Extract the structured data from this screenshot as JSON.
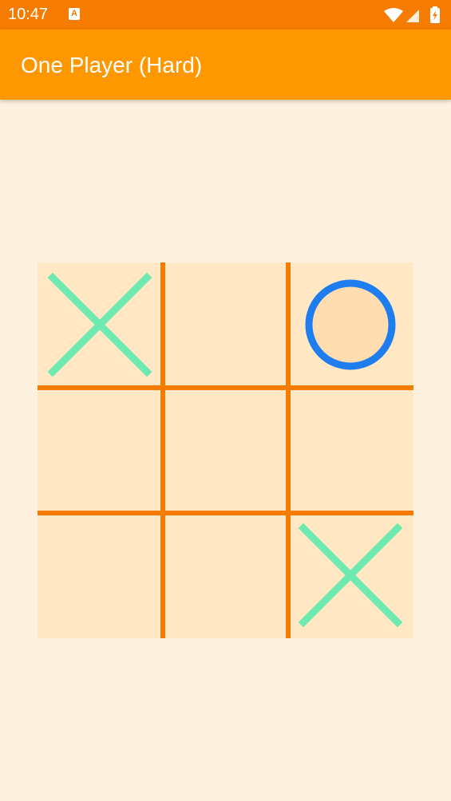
{
  "status": {
    "time": "10:47",
    "notification_glyph": "A",
    "icons": [
      "wifi-icon",
      "cell-signal-icon",
      "battery-charging-icon"
    ]
  },
  "app_bar": {
    "title": "One Player (Hard)"
  },
  "board": {
    "cells": [
      "X",
      "",
      "O",
      "",
      "",
      "",
      "",
      "",
      "X"
    ]
  },
  "colors": {
    "status_bar": "#F57C00",
    "app_bar": "#FF9800",
    "background": "#FFF1E0",
    "board": "#FFE8C3",
    "grid_line": "#F57C00",
    "x_mark": "#6EEAB0",
    "o_mark": "#1E7EF0",
    "o_fill": "#FFDDB0"
  }
}
